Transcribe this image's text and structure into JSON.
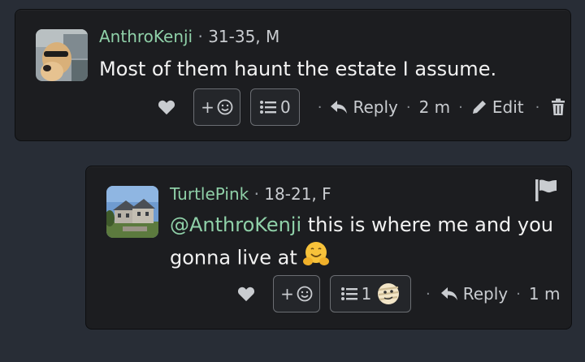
{
  "comments": [
    {
      "username": "AnthroKenji",
      "demographic": "31-35, M",
      "separator": "·",
      "text": "Most of them haunt the estate I assume.",
      "reply_count": "0",
      "reply_label": "Reply",
      "time": "2 m",
      "edit_label": "Edit",
      "avatar_icon": "dog-with-sunglasses-avatar"
    },
    {
      "username": "TurtlePink",
      "demographic": "18-21, F",
      "separator": "·",
      "mention": "@AnthroKenji",
      "text": " this is where me and you gonna live at",
      "inline_emoji": "hugging-face-emoji",
      "reply_count": "1",
      "reply_label": "Reply",
      "time": "1 m",
      "avatar_icon": "mansion-photo-avatar"
    }
  ],
  "common": {
    "react_plus": "+",
    "dot": "·"
  },
  "colors": {
    "background": "#282d36",
    "card": "#1c1d20",
    "username": "#8fd0a8",
    "text": "#f2f2f2",
    "muted": "#c9ccd0"
  }
}
